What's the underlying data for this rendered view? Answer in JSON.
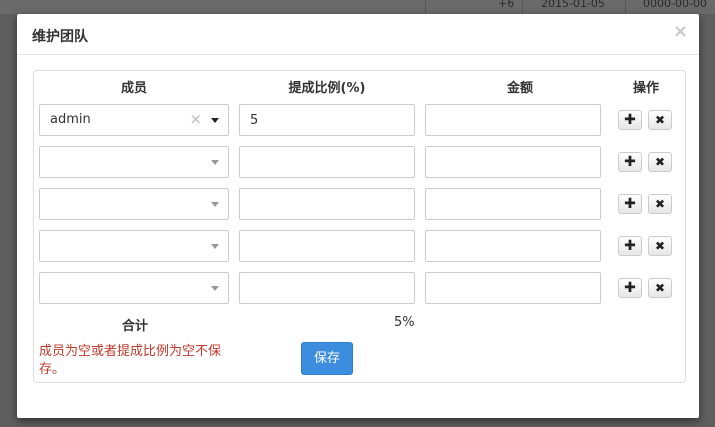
{
  "background": {
    "cells": [
      "+6",
      "2015-01-05",
      "0000-00-00"
    ]
  },
  "modal": {
    "title": "维护团队",
    "close_symbol": "×"
  },
  "table": {
    "headers": {
      "member": "成员",
      "ratio": "提成比例(%)",
      "amount": "金额",
      "ops": "操作"
    },
    "rows": [
      {
        "member": "admin",
        "ratio": "5",
        "amount": ""
      },
      {
        "member": "",
        "ratio": "",
        "amount": ""
      },
      {
        "member": "",
        "ratio": "",
        "amount": ""
      },
      {
        "member": "",
        "ratio": "",
        "amount": ""
      },
      {
        "member": "",
        "ratio": "",
        "amount": ""
      }
    ],
    "add_symbol": "✚",
    "delete_symbol": "✖"
  },
  "total": {
    "label": "合计",
    "ratio": "5%"
  },
  "error_message": "成员为空或者提成比例为空不保存。",
  "save_label": "保存",
  "colors": {
    "save_button": "#3c8dde",
    "error_text": "#c0392b"
  }
}
